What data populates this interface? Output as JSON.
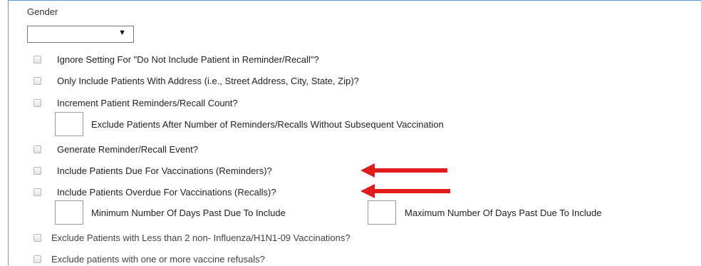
{
  "gender": {
    "label": "Gender",
    "selected_value": "",
    "dropdown_icon": "triangle-down-icon"
  },
  "options": [
    {
      "label": "Ignore Setting For \"Do Not Include Patient in Reminder/Recall\"?",
      "checked": false
    },
    {
      "label": "Only Include Patients With Address (i.e., Street Address, City, State, Zip)?",
      "checked": false
    },
    {
      "label": "Increment Patient Reminders/Recall Count?",
      "checked": false
    },
    {
      "label": "Generate Reminder/Recall Event?",
      "checked": false
    },
    {
      "label": "Include Patients Due For Vaccinations (Reminders)?",
      "checked": false
    },
    {
      "label": "Include Patients Overdue For Vaccinations (Recalls)?",
      "checked": false
    },
    {
      "label": "Exclude Patients with Less than 2 non- Influenza/H1N1-09 Vaccinations?",
      "checked": false
    },
    {
      "label": "Exclude patients with one or more vaccine refusals?",
      "checked": false
    }
  ],
  "exclude_after_label": "Exclude Patients After Number of Reminders/Recalls Without Subsequent Vaccination",
  "exclude_after_value": "",
  "min_days_label": "Minimum Number Of Days Past Due To Include",
  "min_days_value": "",
  "max_days_label": "Maximum Number Of Days Past Due To Include",
  "max_days_value": "",
  "annotation_color": "#e31b1b"
}
